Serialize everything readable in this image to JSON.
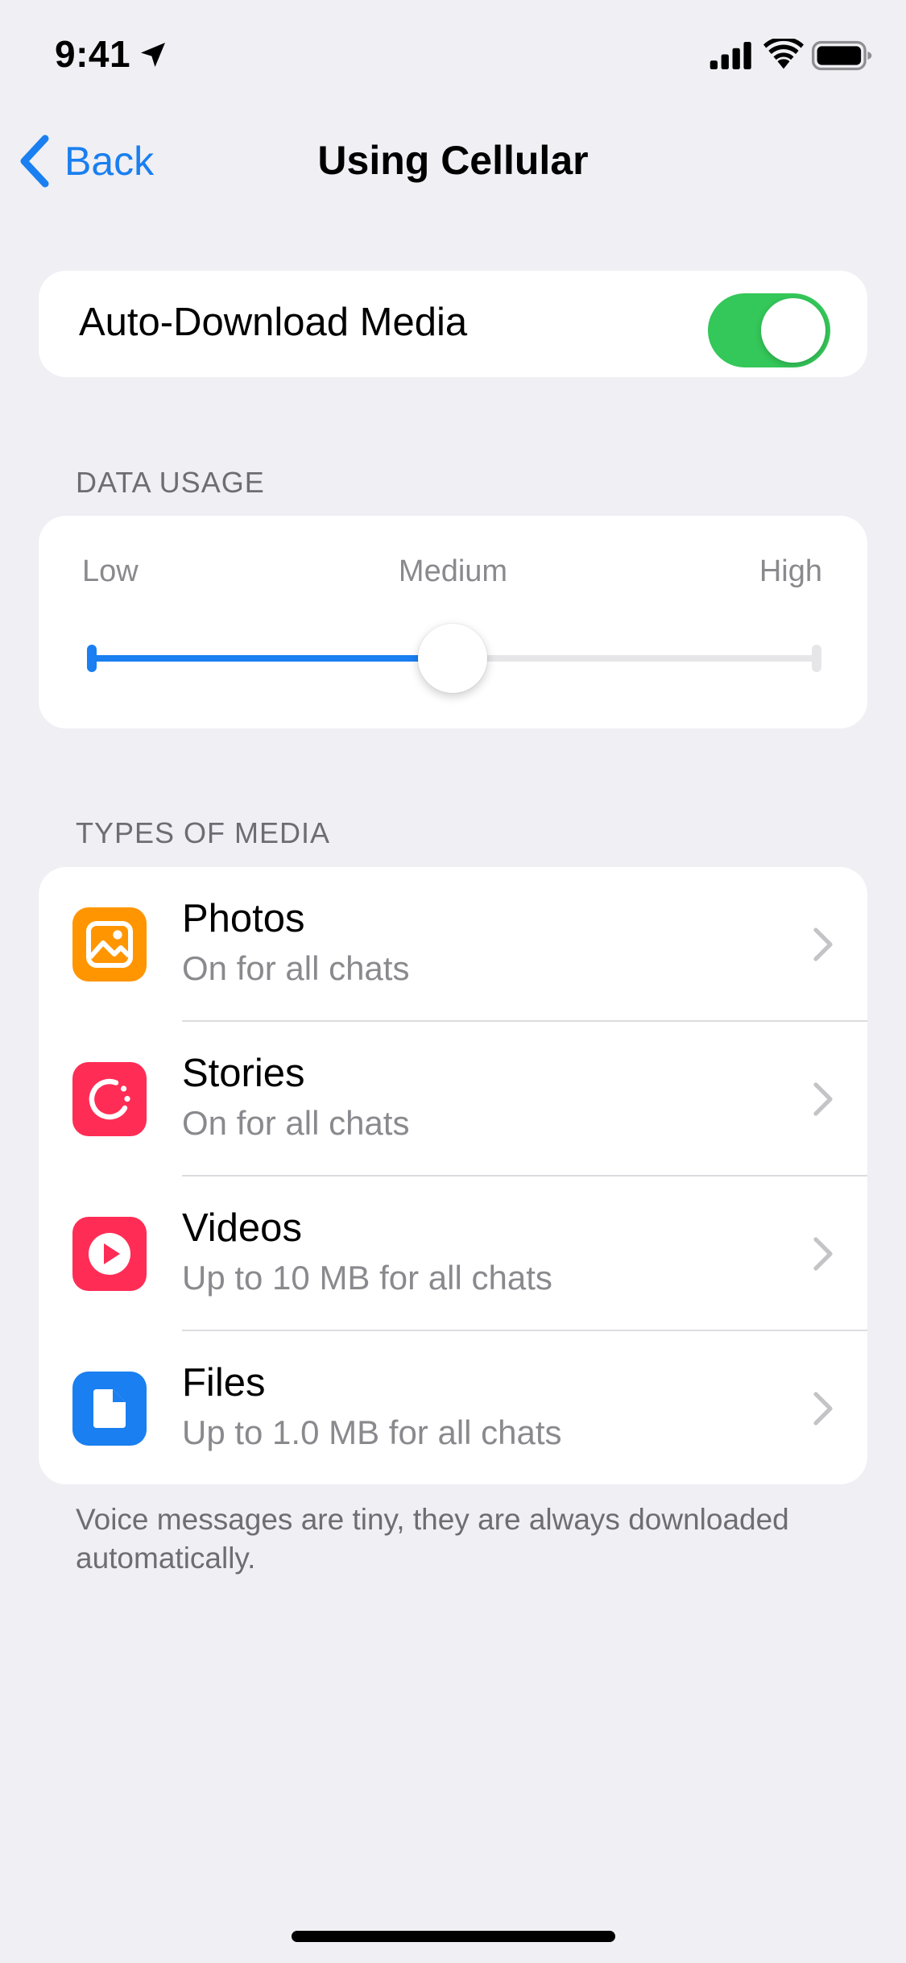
{
  "status_bar": {
    "time": "9:41",
    "icons": [
      "location-arrow-icon",
      "cellular-signal-icon",
      "wifi-icon",
      "battery-icon"
    ]
  },
  "nav": {
    "back_label": "Back",
    "title": "Using Cellular"
  },
  "auto_download": {
    "label": "Auto-Download Media",
    "enabled": true
  },
  "data_usage": {
    "header": "DATA USAGE",
    "labels": {
      "low": "Low",
      "medium": "Medium",
      "high": "High"
    },
    "value_fraction": 0.5
  },
  "media_types": {
    "header": "TYPES OF MEDIA",
    "items": [
      {
        "title": "Photos",
        "subtitle": "On for all chats",
        "icon": "photo-icon",
        "color": "#ff9500"
      },
      {
        "title": "Stories",
        "subtitle": "On for all chats",
        "icon": "stories-icon",
        "color": "#ff2d55"
      },
      {
        "title": "Videos",
        "subtitle": "Up to 10 MB for all chats",
        "icon": "video-play-icon",
        "color": "#ff2d55"
      },
      {
        "title": "Files",
        "subtitle": "Up to 1.0 MB for all chats",
        "icon": "file-icon",
        "color": "#1a7ff0"
      }
    ]
  },
  "footnote": "Voice messages are tiny, they are always downloaded automatically.",
  "colors": {
    "accent": "#1a7ff0",
    "toggle_on": "#34c759",
    "background": "#efeff4"
  }
}
